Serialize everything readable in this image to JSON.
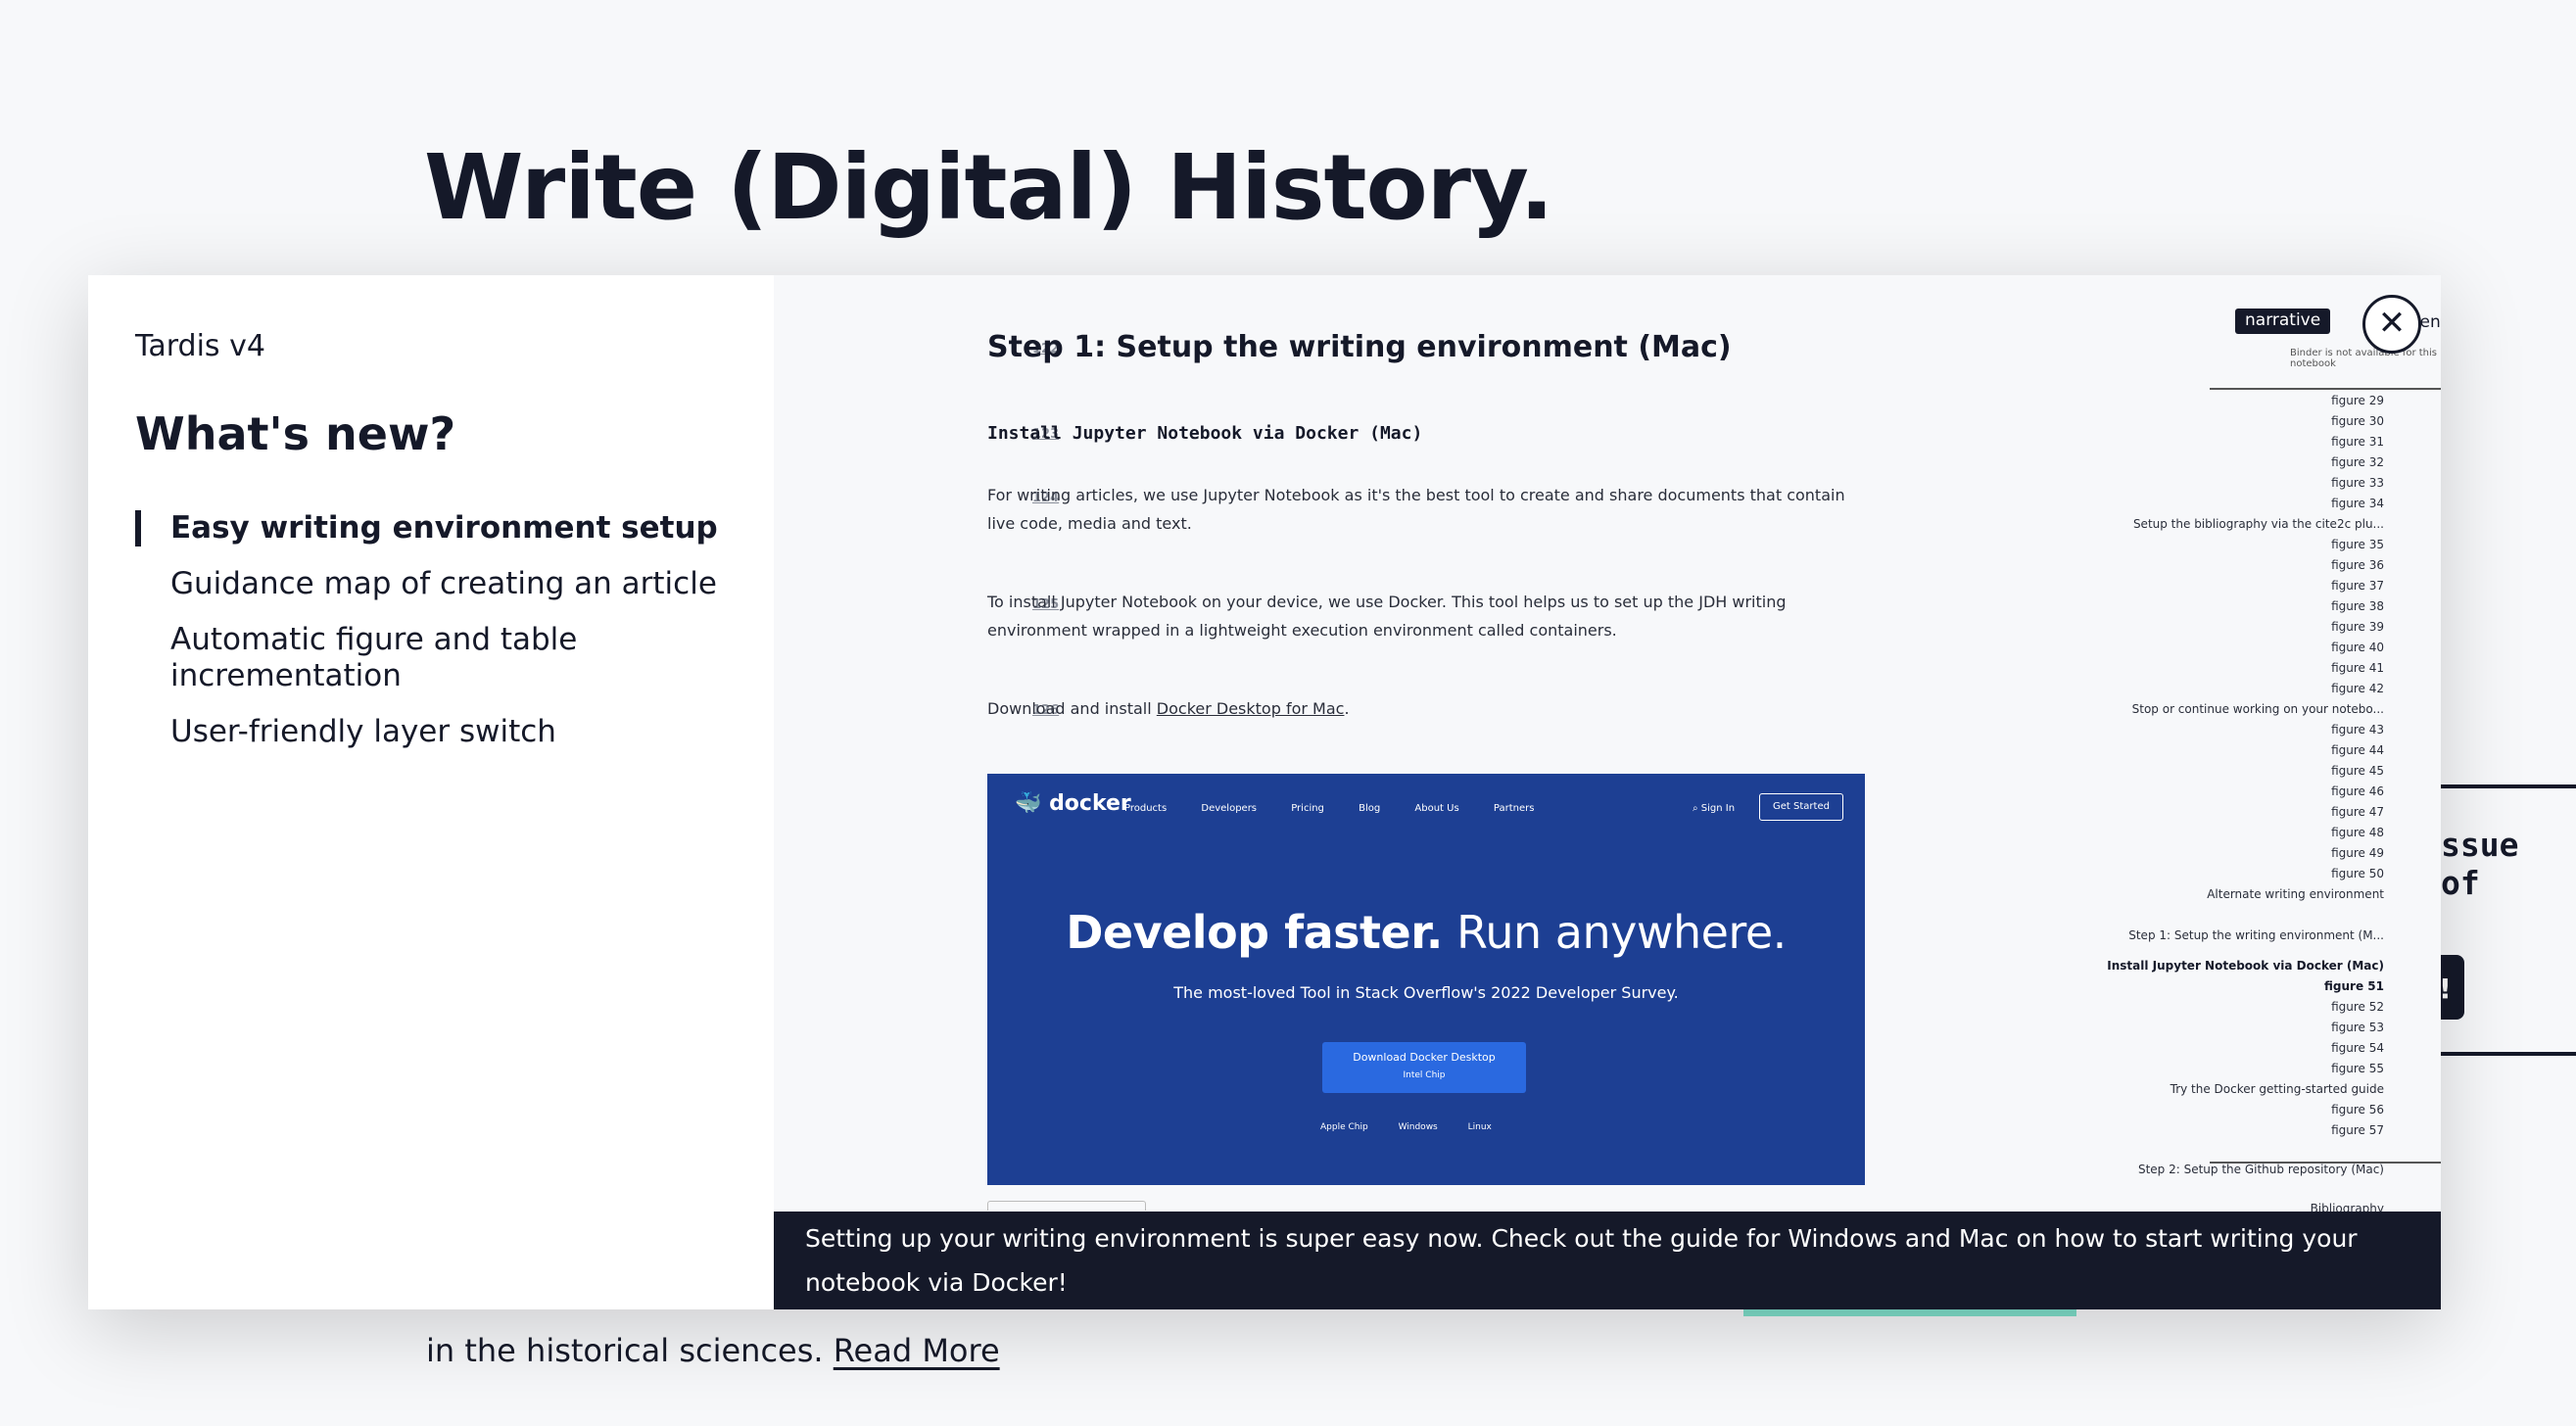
{
  "background": {
    "title": "Write (Digital) History.",
    "text_before_link": "in the historical sciences.",
    "read_more": "Read More",
    "mono_fragment": "ssue of",
    "button_fragment": "!"
  },
  "modal": {
    "version": "Tardis v4",
    "heading": "What's new?",
    "features": [
      "Easy writing environment setup",
      "Guidance map of creating an article",
      "Automatic figure and table incrementation",
      "User-friendly layer switch"
    ],
    "close_label": "✕",
    "caption": "Setting up your writing environment is super easy now. Check out the guide for Windows and Mac on how to start writing your notebook via Docker!"
  },
  "notebook": {
    "cells": [
      {
        "line": "122",
        "text": "Step 1: Setup the writing environment (Mac)"
      },
      {
        "line": "123",
        "text": "Install Jupyter Notebook via Docker (Mac)"
      },
      {
        "line": "124",
        "text": "For writing articles, we use Jupyter Notebook as it's the best tool to create and share documents that contain live code, media and text."
      },
      {
        "line": "125",
        "text": "To install Jupyter Notebook on your device, we use Docker. This tool helps us to set up the JDH writing environment wrapped in a lightweight execution environment called containers."
      },
      {
        "line": "126",
        "text_before": "Download and install ",
        "link": "Docker Desktop for Mac",
        "text_after": "."
      }
    ],
    "docker": {
      "logo": "docker",
      "menu": [
        "Products",
        "Developers",
        "Pricing",
        "Blog",
        "About Us",
        "Partners"
      ],
      "signin": "Sign In",
      "get_started": "Get Started",
      "hero_bold": "Develop faster.",
      "hero_rest": " Run anywhere.",
      "subtitle": "The most-loved Tool in Stack Overflow's 2022 Developer Survey.",
      "download": "Download Docker Desktop",
      "chip": "Intel Chip",
      "os": [
        "Apple Chip",
        "Windows",
        "Linux"
      ]
    }
  },
  "navigator": {
    "tag_active": "narrative",
    "tag_other": "hermeneu",
    "binder_note": "Binder is not available for this notebook",
    "items": [
      {
        "label": "figure 29"
      },
      {
        "label": "figure 30"
      },
      {
        "label": "figure 31"
      },
      {
        "label": "figure 32"
      },
      {
        "label": "figure 33"
      },
      {
        "label": "figure 34"
      },
      {
        "label": "Setup the bibliography via the cite2c plu..."
      },
      {
        "label": "figure 35"
      },
      {
        "label": "figure 36"
      },
      {
        "label": "figure 37"
      },
      {
        "label": "figure 38"
      },
      {
        "label": "figure 39"
      },
      {
        "label": "figure 40"
      },
      {
        "label": "figure 41"
      },
      {
        "label": "figure 42"
      },
      {
        "label": "Stop or continue working on your notebo..."
      },
      {
        "label": "figure 43"
      },
      {
        "label": "figure 44"
      },
      {
        "label": "figure 45"
      },
      {
        "label": "figure 46"
      },
      {
        "label": "figure 47"
      },
      {
        "label": "figure 48"
      },
      {
        "label": "figure 49"
      },
      {
        "label": "figure 50"
      },
      {
        "label": "Alternate writing environment"
      },
      {
        "label": "Step 1: Setup the writing environment (M..."
      },
      {
        "label": "Install Jupyter Notebook via Docker (Mac)"
      },
      {
        "label": "figure 51"
      },
      {
        "label": "figure 52"
      },
      {
        "label": "figure 53"
      },
      {
        "label": "figure 54"
      },
      {
        "label": "figure 55"
      },
      {
        "label": "Try the Docker getting-started guide"
      },
      {
        "label": "figure 56"
      },
      {
        "label": "figure 57"
      },
      {
        "label": "Step 2: Setup the Github repository (Mac)"
      },
      {
        "label": "Bibliography"
      }
    ]
  }
}
